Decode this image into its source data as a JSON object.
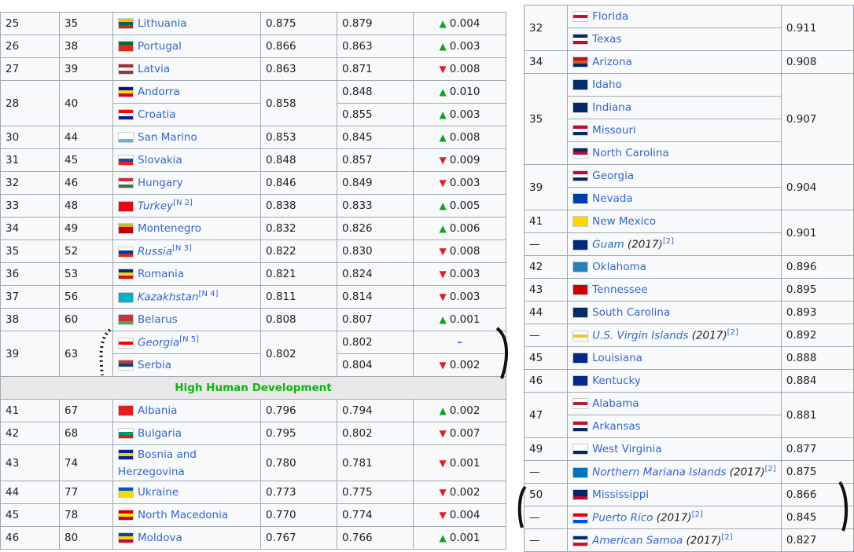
{
  "left_table": {
    "rows": [
      {
        "rank": "25",
        "rank2": "35",
        "name": "Lithuania",
        "flag": [
          "#fdb913",
          "#006a44",
          "#c1272d"
        ],
        "v1": "0.875",
        "v2": "0.879",
        "dir": "up",
        "chg": "0.004"
      },
      {
        "rank": "26",
        "rank2": "38",
        "name": "Portugal",
        "flag": [
          "#046a38",
          "#da291c",
          "#da291c"
        ],
        "v1": "0.866",
        "v2": "0.863",
        "dir": "up",
        "chg": "0.003"
      },
      {
        "rank": "27",
        "rank2": "39",
        "name": "Latvia",
        "flag": [
          "#9e3039",
          "#ffffff",
          "#9e3039"
        ],
        "v1": "0.863",
        "v2": "0.871",
        "dir": "down",
        "chg": "0.008"
      },
      {
        "rank": "28",
        "rank2": "40",
        "name": "Andorra",
        "flag": [
          "#10069f",
          "#fedf00",
          "#d50032"
        ],
        "v1": "0.858",
        "v2": "0.848",
        "dir": "up",
        "chg": "0.010",
        "group": "a"
      },
      {
        "name": "Croatia",
        "flag": [
          "#ff0000",
          "#ffffff",
          "#171796"
        ],
        "v2": "0.855",
        "dir": "up",
        "chg": "0.003",
        "group": "a"
      },
      {
        "rank": "30",
        "rank2": "44",
        "name": "San Marino",
        "flag": [
          "#ffffff",
          "#ffffff",
          "#5eb6e4"
        ],
        "v1": "0.853",
        "v2": "0.845",
        "dir": "up",
        "chg": "0.008"
      },
      {
        "rank": "31",
        "rank2": "45",
        "name": "Slovakia",
        "flag": [
          "#ffffff",
          "#0b4ea2",
          "#ee1c25"
        ],
        "v1": "0.848",
        "v2": "0.857",
        "dir": "down",
        "chg": "0.009"
      },
      {
        "rank": "32",
        "rank2": "46",
        "name": "Hungary",
        "flag": [
          "#cd2a3e",
          "#ffffff",
          "#436f4d"
        ],
        "v1": "0.846",
        "v2": "0.849",
        "dir": "down",
        "chg": "0.003"
      },
      {
        "rank": "33",
        "rank2": "48",
        "name": "Turkey",
        "italic": true,
        "note": "[N 2]",
        "flag": [
          "#e30a17",
          "#e30a17",
          "#e30a17"
        ],
        "v1": "0.838",
        "v2": "0.833",
        "dir": "up",
        "chg": "0.005"
      },
      {
        "rank": "34",
        "rank2": "49",
        "name": "Montenegro",
        "flag": [
          "#d4af3a",
          "#c40308",
          "#c40308"
        ],
        "v1": "0.832",
        "v2": "0.826",
        "dir": "up",
        "chg": "0.006"
      },
      {
        "rank": "35",
        "rank2": "52",
        "name": "Russia",
        "italic": true,
        "note": "[N 3]",
        "flag": [
          "#ffffff",
          "#0039a6",
          "#d52b1e"
        ],
        "v1": "0.822",
        "v2": "0.830",
        "dir": "down",
        "chg": "0.008"
      },
      {
        "rank": "36",
        "rank2": "53",
        "name": "Romania",
        "flag": [
          "#002b7f",
          "#fcd116",
          "#ce1126"
        ],
        "v1": "0.821",
        "v2": "0.824",
        "dir": "down",
        "chg": "0.003"
      },
      {
        "rank": "37",
        "rank2": "56",
        "name": "Kazakhstan",
        "italic": true,
        "note": "[N 4]",
        "flag": [
          "#00afca",
          "#00afca",
          "#00afca"
        ],
        "v1": "0.811",
        "v2": "0.814",
        "dir": "down",
        "chg": "0.003"
      },
      {
        "rank": "38",
        "rank2": "60",
        "name": "Belarus",
        "flag": [
          "#c8313e",
          "#c8313e",
          "#4aa657"
        ],
        "v1": "0.808",
        "v2": "0.807",
        "dir": "up",
        "chg": "0.001"
      },
      {
        "rank": "39",
        "rank2": "63",
        "name": "Georgia",
        "italic": true,
        "note": "[N 5]",
        "flag": [
          "#ffffff",
          "#ff0000",
          "#ffffff"
        ],
        "v1": "0.802",
        "v2": "0.802",
        "dir": "none",
        "chg": "–",
        "group": "b"
      },
      {
        "name": "Serbia",
        "flag": [
          "#c6363c",
          "#0c4076",
          "#ffffff"
        ],
        "v2": "0.804",
        "dir": "down",
        "chg": "0.002",
        "group": "b"
      }
    ],
    "section_header": "High Human Development",
    "rows2": [
      {
        "rank": "41",
        "rank2": "67",
        "name": "Albania",
        "flag": [
          "#e41e20",
          "#e41e20",
          "#e41e20"
        ],
        "v1": "0.796",
        "v2": "0.794",
        "dir": "up",
        "chg": "0.002"
      },
      {
        "rank": "42",
        "rank2": "68",
        "name": "Bulgaria",
        "flag": [
          "#ffffff",
          "#00966e",
          "#d62612"
        ],
        "v1": "0.795",
        "v2": "0.802",
        "dir": "down",
        "chg": "0.007"
      },
      {
        "rank": "43",
        "rank2": "74",
        "name": "Bosnia and Herzegovina",
        "flag": [
          "#002395",
          "#fecb00",
          "#002395"
        ],
        "v1": "0.780",
        "v2": "0.781",
        "dir": "down",
        "chg": "0.001",
        "tall": true
      },
      {
        "rank": "44",
        "rank2": "77",
        "name": "Ukraine",
        "flag": [
          "#0057b7",
          "#ffd700",
          "#ffd700"
        ],
        "v1": "0.773",
        "v2": "0.775",
        "dir": "down",
        "chg": "0.002"
      },
      {
        "rank": "45",
        "rank2": "78",
        "name": "North Macedonia",
        "flag": [
          "#d20000",
          "#ffe600",
          "#d20000"
        ],
        "v1": "0.770",
        "v2": "0.774",
        "dir": "down",
        "chg": "0.004"
      },
      {
        "rank": "46",
        "rank2": "80",
        "name": "Moldova",
        "flag": [
          "#0046ae",
          "#ffd200",
          "#cc092f"
        ],
        "v1": "0.767",
        "v2": "0.766",
        "dir": "up",
        "chg": "0.001"
      }
    ]
  },
  "right_table": {
    "rows": [
      {
        "rank": "32",
        "name": "Florida",
        "flag": [
          "#ffffff",
          "#c8102e",
          "#ffffff"
        ],
        "v": "0.911",
        "span_rank": 2,
        "span_v": 2
      },
      {
        "name": "Texas",
        "flag": [
          "#002868",
          "#ffffff",
          "#bf0a30"
        ]
      },
      {
        "rank": "34",
        "name": "Arizona",
        "flag": [
          "#bf0a30",
          "#ce5c17",
          "#002868"
        ],
        "v": "0.908"
      },
      {
        "rank": "35",
        "name": "Idaho",
        "flag": [
          "#002f6c",
          "#002f6c",
          "#002f6c"
        ],
        "v": "0.907",
        "span_rank": 4,
        "span_v": 4
      },
      {
        "name": "Indiana",
        "flag": [
          "#002868",
          "#002868",
          "#002868"
        ]
      },
      {
        "name": "Missouri",
        "flag": [
          "#bf0a30",
          "#ffffff",
          "#002868"
        ]
      },
      {
        "name": "North Carolina",
        "flag": [
          "#002868",
          "#bf0a30",
          "#ffffff"
        ]
      },
      {
        "rank": "39",
        "name": "Georgia",
        "flag": [
          "#bf0a30",
          "#ffffff",
          "#002868"
        ],
        "v": "0.904",
        "span_rank": 2,
        "span_v": 2
      },
      {
        "name": "Nevada",
        "flag": [
          "#003da5",
          "#003da5",
          "#003da5"
        ]
      },
      {
        "rank": "41",
        "name": "New Mexico",
        "flag": [
          "#ffd700",
          "#ffd700",
          "#ffd700"
        ],
        "v": "0.901",
        "span_v": 2
      },
      {
        "rank": "—",
        "name": "Guam",
        "italic": true,
        "extra": "(2017)",
        "note": "[2]",
        "flag": [
          "#00297b",
          "#00297b",
          "#00297b"
        ]
      },
      {
        "rank": "42",
        "name": "Oklahoma",
        "flag": [
          "#2a7fba",
          "#2a7fba",
          "#2a7fba"
        ],
        "v": "0.896"
      },
      {
        "rank": "43",
        "name": "Tennessee",
        "flag": [
          "#cc0000",
          "#cc0000",
          "#cc0000"
        ],
        "v": "0.895"
      },
      {
        "rank": "44",
        "name": "South Carolina",
        "flag": [
          "#002d62",
          "#002d62",
          "#002d62"
        ],
        "v": "0.893"
      },
      {
        "rank": "—",
        "name": "U.S. Virgin Islands",
        "italic": true,
        "extra": "(2017)",
        "note": "[2]",
        "flag": [
          "#ffffff",
          "#f4c430",
          "#ffffff"
        ],
        "v": "0.892"
      },
      {
        "rank": "45",
        "name": "Louisiana",
        "flag": [
          "#002a86",
          "#002a86",
          "#002a86"
        ],
        "v": "0.888"
      },
      {
        "rank": "46",
        "name": "Kentucky",
        "flag": [
          "#002a86",
          "#002a86",
          "#002a86"
        ],
        "v": "0.884"
      },
      {
        "rank": "47",
        "name": "Alabama",
        "flag": [
          "#ffffff",
          "#b22234",
          "#ffffff"
        ],
        "v": "0.881",
        "span_rank": 2,
        "span_v": 2
      },
      {
        "name": "Arkansas",
        "flag": [
          "#c8102e",
          "#ffffff",
          "#002868"
        ]
      },
      {
        "rank": "49",
        "name": "West Virginia",
        "flag": [
          "#ffffff",
          "#ffffff",
          "#002855"
        ],
        "v": "0.877"
      },
      {
        "rank": "—",
        "name": "Northern Mariana Islands",
        "italic": true,
        "extra": "(2017)",
        "note": "[2]",
        "flag": [
          "#0071bc",
          "#0071bc",
          "#0071bc"
        ],
        "v": "0.875"
      },
      {
        "rank": "50",
        "name": "Mississippi",
        "flag": [
          "#002868",
          "#002868",
          "#bf0a30"
        ],
        "v": "0.866"
      },
      {
        "rank": "—",
        "name": "Puerto Rico",
        "italic": true,
        "extra": "(2017)",
        "note": "[2]",
        "flag": [
          "#ed0000",
          "#ffffff",
          "#0050f0"
        ],
        "v": "0.845"
      },
      {
        "rank": "—",
        "name": "American Samoa",
        "italic": true,
        "extra": "(2017)",
        "note": "[2]",
        "flag": [
          "#002b7f",
          "#ffffff",
          "#ce1126"
        ],
        "v": "0.827"
      }
    ]
  },
  "arrows": {
    "up": "▲",
    "down": "▼",
    "none": "–"
  }
}
